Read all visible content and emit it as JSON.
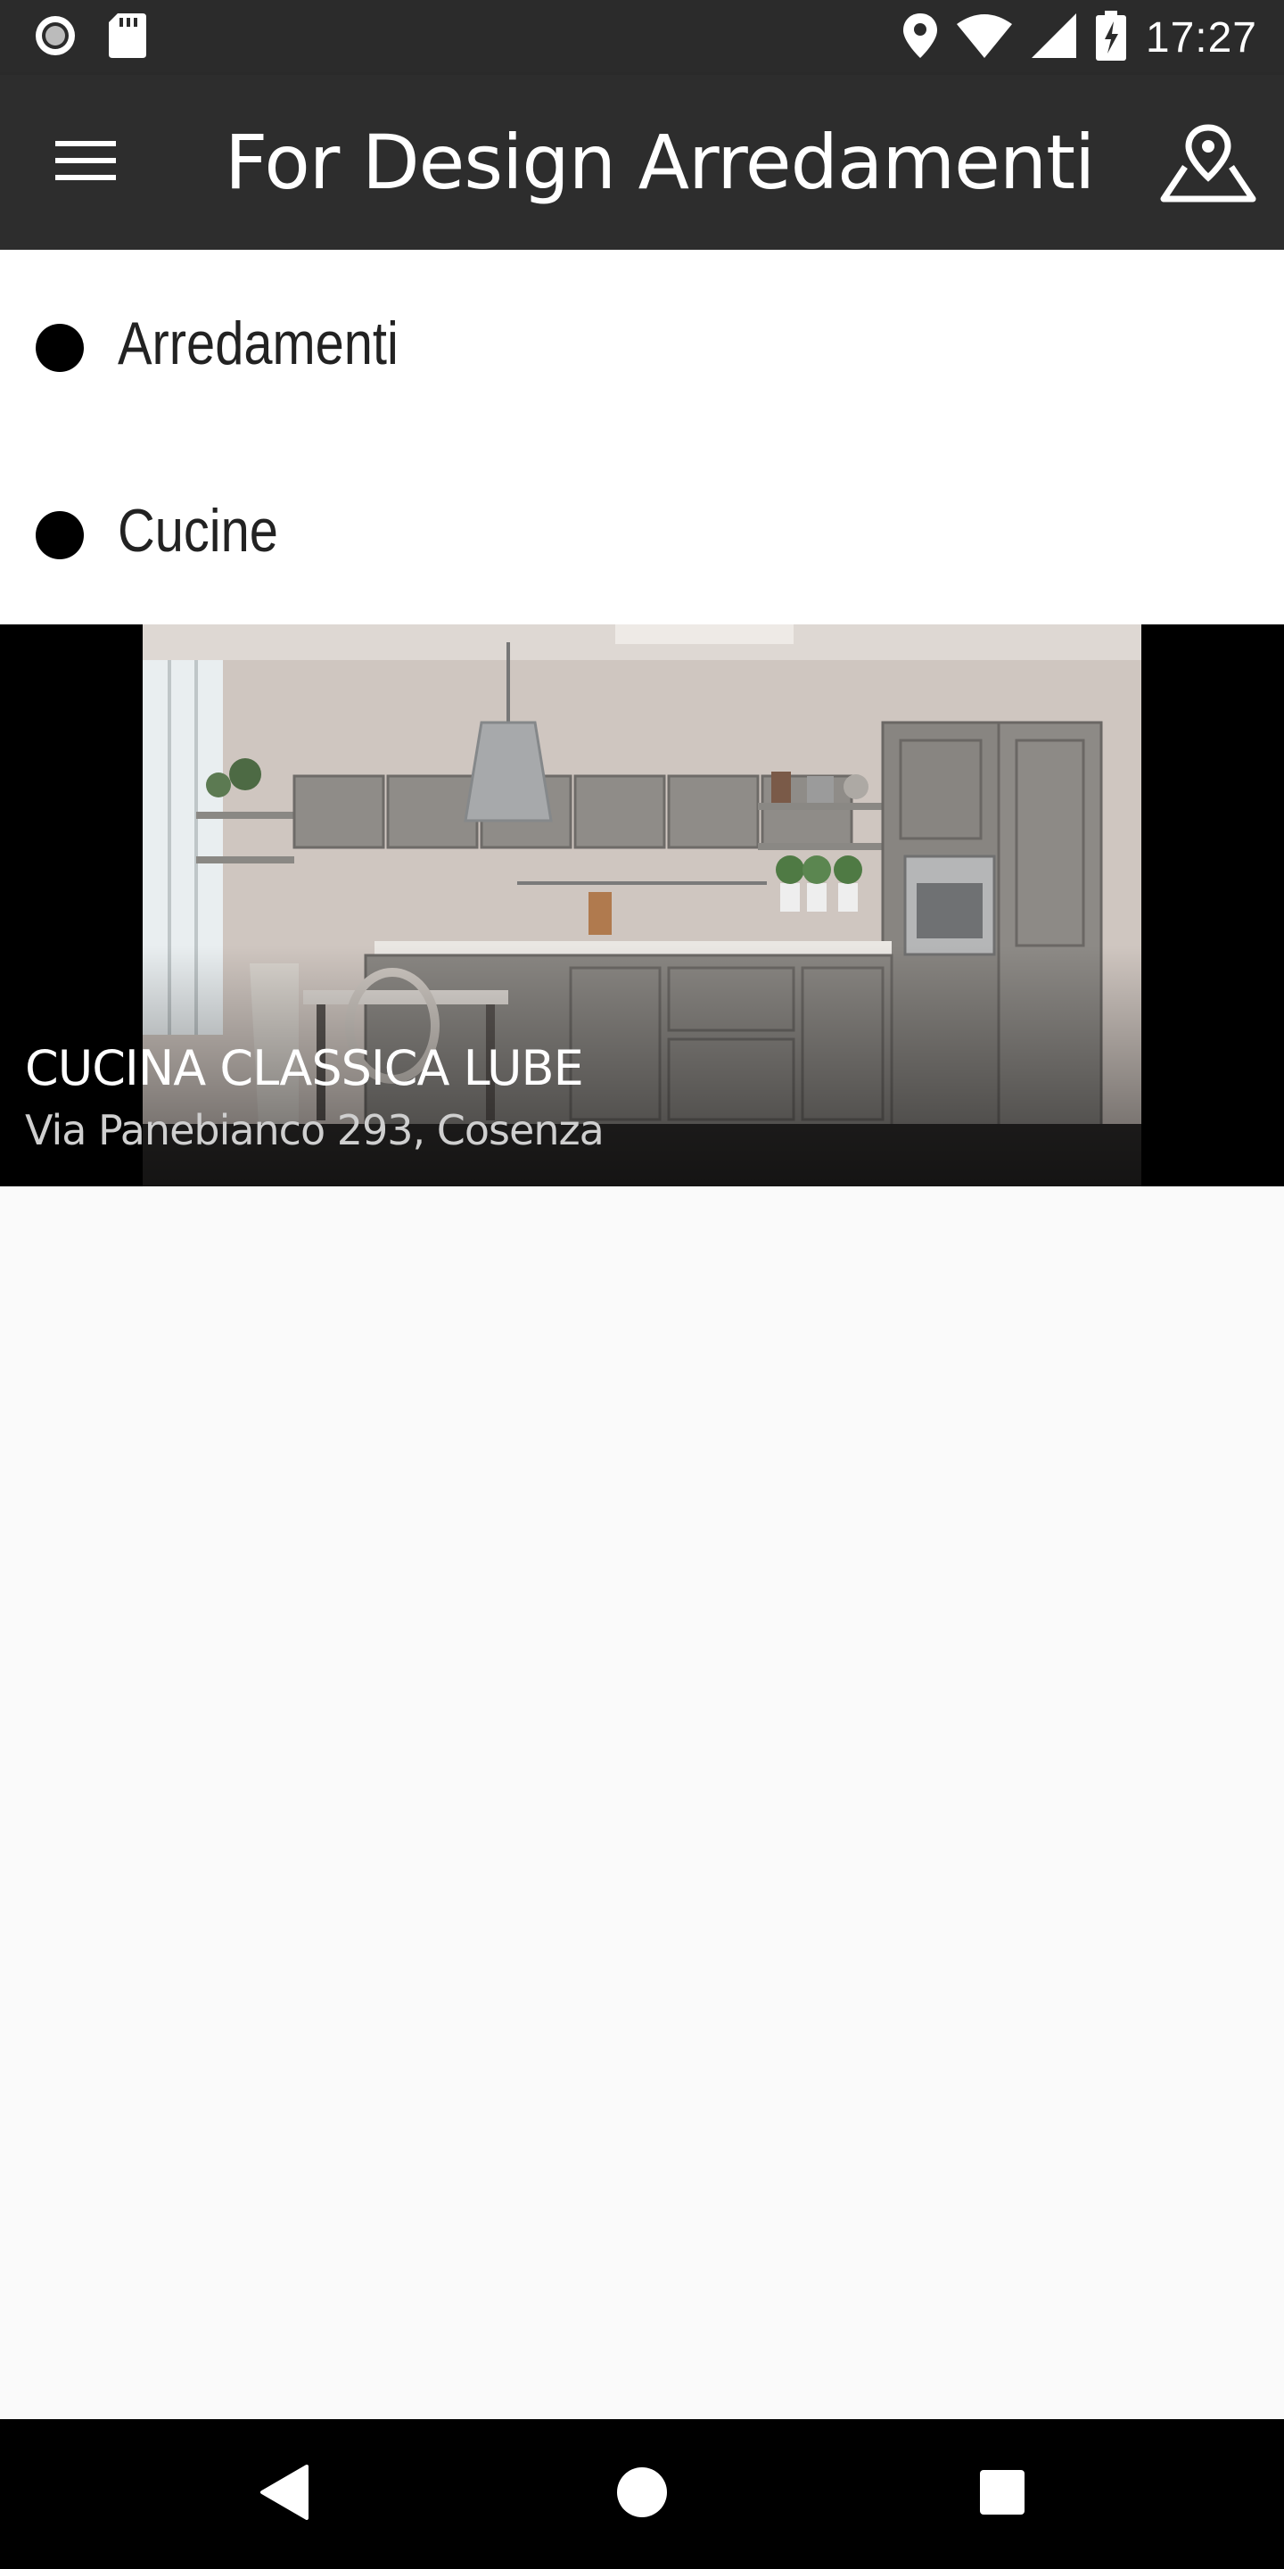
{
  "status_bar": {
    "time": "17:27",
    "icons": [
      "record-icon",
      "sd-card-icon",
      "location-icon",
      "wifi-icon",
      "signal-icon",
      "battery-charging-icon"
    ]
  },
  "app_bar": {
    "title": "For Design Arredamenti",
    "menu_icon": "hamburger-menu-icon",
    "map_icon": "map-pin-icon"
  },
  "categories": [
    {
      "label": "Arredamenti"
    },
    {
      "label": "Cucine"
    }
  ],
  "feature_card": {
    "title": "CUCINA CLASSICA LUBE",
    "address": "Via Panebianco 293, Cosenza"
  },
  "nav_bar": {
    "icons": [
      "back-icon",
      "home-icon",
      "recents-icon"
    ]
  }
}
